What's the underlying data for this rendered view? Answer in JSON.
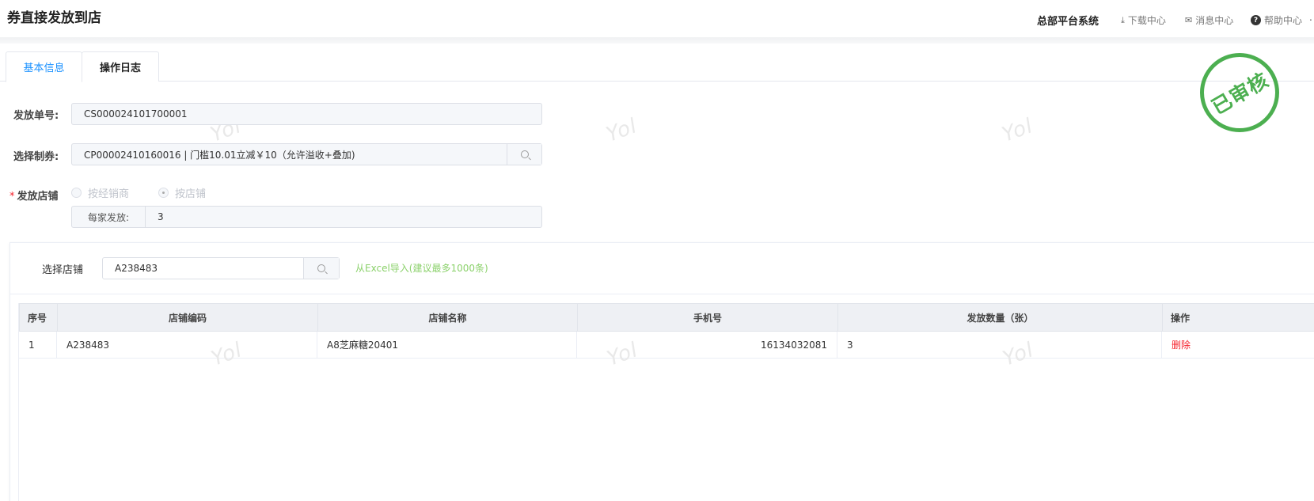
{
  "header": {
    "title": "券直接发放到店",
    "system_name": "总部平台系统",
    "download_center": "下载中心",
    "message_center": "消息中心",
    "help_center": "帮助中心"
  },
  "tabs": [
    "基本信息",
    "操作日志"
  ],
  "stamp": "已审核",
  "watermark": "Yol",
  "form": {
    "order_no_label": "发放单号:",
    "order_no_value": "CS000024101700001",
    "coupon_label": "选择制券:",
    "coupon_value": "CP00002410160016 | 门槛10.01立减￥10（允许溢收+叠加)",
    "store_label": "发放店铺",
    "radio_dealer": "按经销商",
    "radio_store": "按店铺",
    "radio_selected": "按店铺",
    "per_store_label": "每家发放:",
    "per_store_value": "3"
  },
  "store_select": {
    "label": "选择店铺",
    "search_value": "A238483",
    "excel_import": "从Excel导入(建议最多1000条)"
  },
  "table": {
    "headers": [
      "序号",
      "店铺编码",
      "店铺名称",
      "手机号",
      "发放数量（张）",
      "操作"
    ],
    "rows": [
      {
        "index": "1",
        "code": "A238483",
        "name": "A8芝麻糖20401",
        "phone": "16134032081",
        "qty": "3",
        "action": "删除"
      }
    ]
  },
  "colors": {
    "accent": "#1890ff",
    "stamp": "#4caf50",
    "danger": "#f5222d",
    "excel_link": "#8bd16b"
  }
}
